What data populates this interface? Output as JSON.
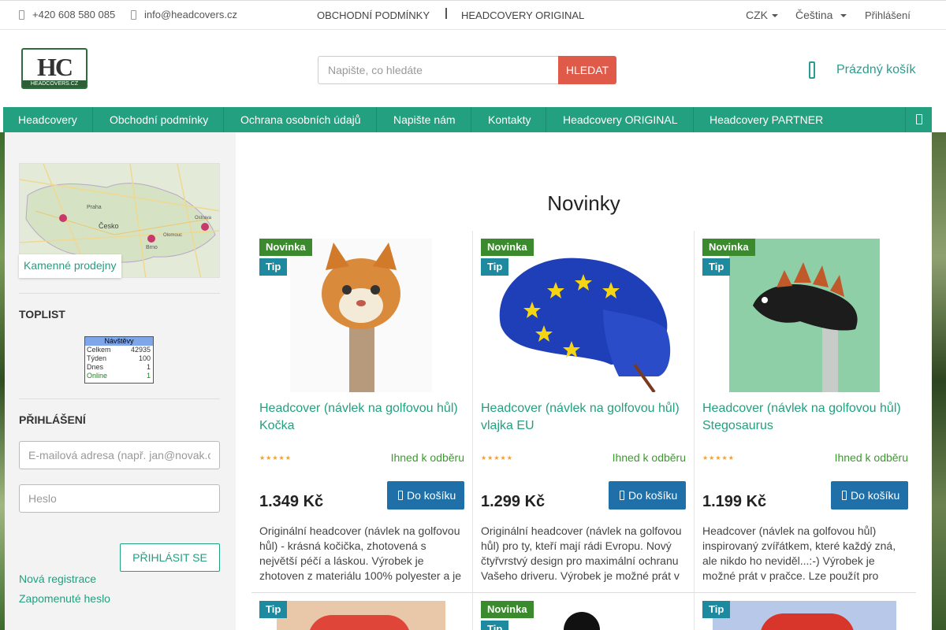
{
  "topbar": {
    "phone": "+420 608 580 085",
    "email": "info@headcovers.cz",
    "links": [
      "OBCHODNÍ PODMÍNKY",
      "HEADCOVERY ORIGINAL"
    ],
    "currency": "CZK",
    "language": "Čeština",
    "login": "Přihlášení"
  },
  "header": {
    "logo_letters": "HC",
    "logo_domain": "HEADCOVERS.CZ",
    "search_placeholder": "Napište, co hledáte",
    "search_button": "HLEDAT",
    "cart": "Prázdný košík"
  },
  "nav": [
    "Headcovery",
    "Obchodní podmínky",
    "Ochrana osobních údajů",
    "Napište nám",
    "Kontakty",
    "Headcovery ORIGINAL",
    "Headcovery PARTNER"
  ],
  "sidebar": {
    "map_label": "Kamenné prodejny",
    "map_places": [
      "Praha",
      "Česko",
      "Brno",
      "Olomouc",
      "Ostrava"
    ],
    "toplist_title": "TOPLIST",
    "toplist": {
      "header": "Návštěvy",
      "rows": [
        {
          "label": "Celkem",
          "value": "42935"
        },
        {
          "label": "Týden",
          "value": "100"
        },
        {
          "label": "Dnes",
          "value": "1"
        },
        {
          "label": "Online",
          "value": "1"
        }
      ]
    },
    "login_title": "PŘIHLÁŠENÍ",
    "email_placeholder": "E-mailová adresa (např. jan@novak.cz)",
    "password_placeholder": "Heslo",
    "login_button": "PŘIHLÁSIT SE",
    "register": "Nová registrace",
    "forgot": "Zapomenuté heslo"
  },
  "main": {
    "title": "Novinky",
    "products": [
      {
        "badges": [
          "Novinka",
          "Tip"
        ],
        "name": "Headcover (návlek na golfovou hůl) Kočka",
        "stars": "★★★★★",
        "availability": "Ihned k odběru",
        "price": "1.349 Kč",
        "buy": "Do košíku",
        "description": "Originální headcover (návlek na golfovou hůl) - krásná kočička, zhotovená s největší péčí a láskou. Výrobek je zhotoven z materiálu 100% polyester a je"
      },
      {
        "badges": [
          "Novinka",
          "Tip"
        ],
        "name": "Headcover (návlek na golfovou hůl) vlajka EU",
        "stars": "★★★★★",
        "availability": "Ihned k odběru",
        "price": "1.299 Kč",
        "buy": "Do košíku",
        "description": "Originální headcover (návlek na golfovou hůl) pro ty, kteří mají rádi Evropu. Nový čtyřvrstvý design pro maximální ochranu Vašeho driveru. Výrobek je možné prát v"
      },
      {
        "badges": [
          "Novinka",
          "Tip"
        ],
        "name": "Headcover (návlek na golfovou hůl) Stegosaurus",
        "stars": "★★★★★",
        "availability": "Ihned k odběru",
        "price": "1.199 Kč",
        "buy": "Do košíku",
        "description": "Headcover (návlek na golfovou hůl) inspirovaný zvířátkem, které každý zná, ale nikdo ho neviděl...:-) Výrobek je možné prát v pračce. Lze použít pro"
      }
    ],
    "next_row_badges": [
      [
        "Tip"
      ],
      [
        "Novinka",
        "Tip"
      ],
      [
        "Tip"
      ]
    ]
  },
  "colors": {
    "accent": "#22a07f",
    "badge_new": "#3c8a2e",
    "badge_tip": "#1e8aa0",
    "buy_button": "#1f6fa8",
    "search_button": "#e05a4a"
  }
}
